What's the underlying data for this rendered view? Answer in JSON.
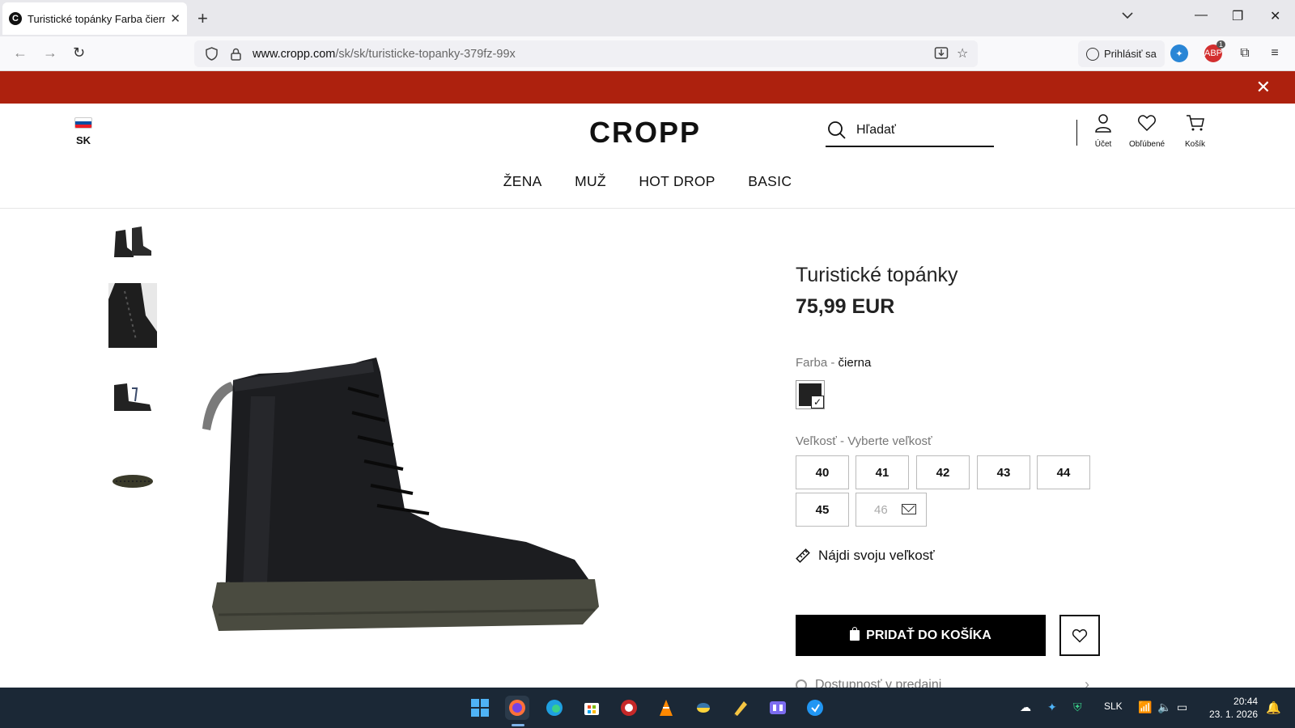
{
  "browser": {
    "tab_title": "Turistické topánky Farba čierna",
    "url_domain": "www.cropp.com",
    "url_path": "/sk/sk/turisticke-topanky-379fz-99x",
    "signin_label": "Prihlásiť sa",
    "extension_badge": "1"
  },
  "site": {
    "lang_code": "SK",
    "logo": "CROPP",
    "search_placeholder": "Hľadať",
    "account_label": "Účet",
    "favorites_label": "Obľúbené",
    "cart_label": "Košík",
    "nav": [
      "ŽENA",
      "MUŽ",
      "HOT DROP",
      "BASIC"
    ]
  },
  "product": {
    "title": "Turistické topánky",
    "price": "75,99 EUR",
    "color_label": "Farba - ",
    "color_value": "čierna",
    "size_label": "Veľkosť - Vyberte veľkosť",
    "sizes": [
      "40",
      "41",
      "42",
      "43",
      "44",
      "45",
      "46"
    ],
    "unavailable_size": "46",
    "find_size": "Nájdi svoju veľkosť",
    "add_to_cart": "PRIDAŤ DO KOŠÍKA",
    "availability": "Dostupnosť v predajni"
  },
  "taskbar": {
    "language": "SLK",
    "time": "20:44",
    "date": "23. 1. 2026"
  },
  "colors": {
    "promo_banner": "#ad210e",
    "taskbar": "#1b2836",
    "primary_button": "#000000"
  }
}
